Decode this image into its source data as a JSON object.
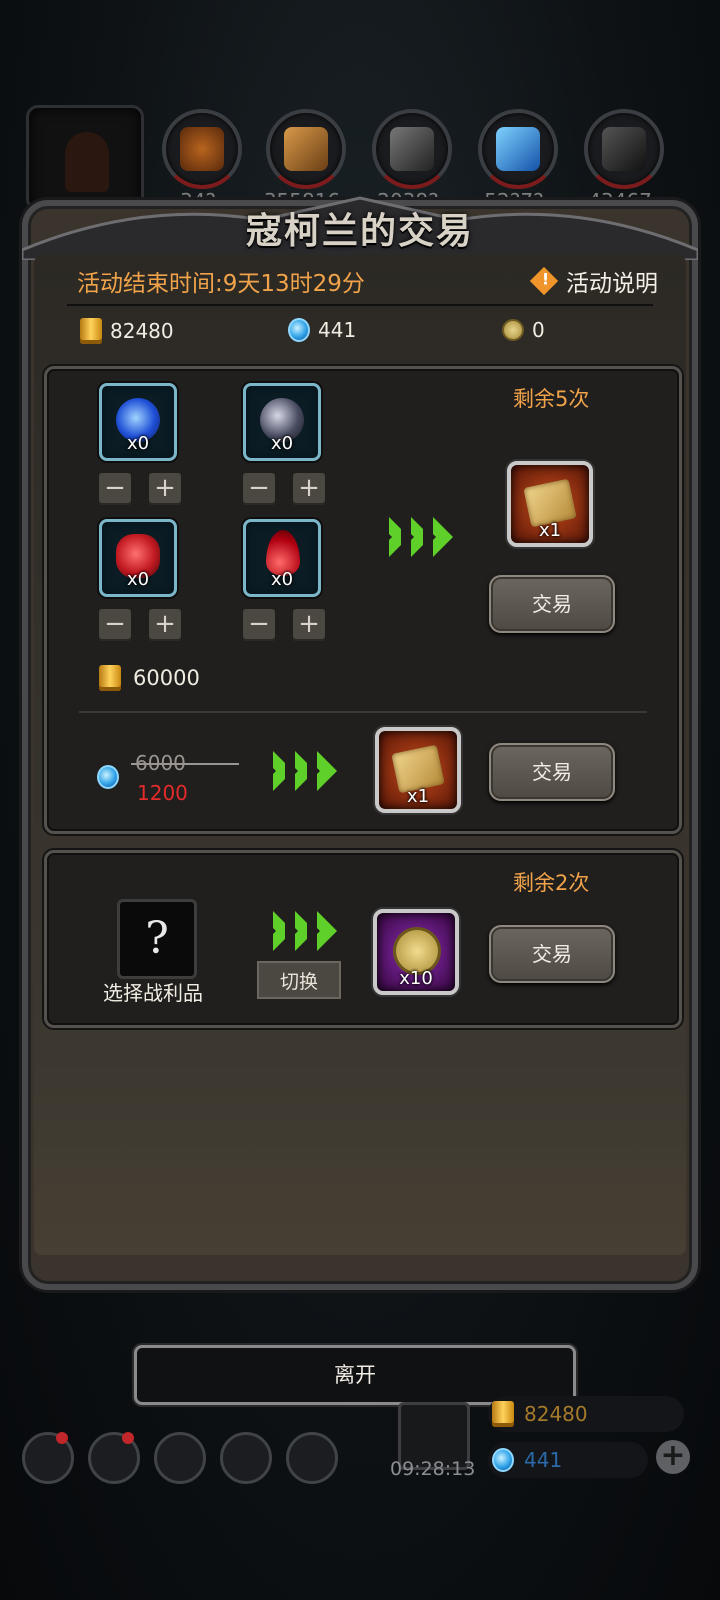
{
  "top_resources": {
    "values": [
      "34?",
      "355816",
      "2038?",
      "52?7?",
      "43467"
    ]
  },
  "modal": {
    "title": "寇柯兰的交易",
    "end_time_label": "活动结束时间:9天13时29分",
    "help_label": "活动说明",
    "help_mark": "!",
    "currency": {
      "gold": "82480",
      "gem": "441",
      "token": "0"
    }
  },
  "panel1": {
    "remaining": "剩余5次",
    "materials": [
      {
        "name": "blue-orb",
        "count": "x0",
        "color": "#2f6cff"
      },
      {
        "name": "dark-ore",
        "count": "x0",
        "color": "#6a6f86"
      },
      {
        "name": "red-crystal",
        "count": "x0",
        "color": "#d8202a"
      },
      {
        "name": "blood-drop",
        "count": "x0",
        "color": "#c4101a"
      }
    ],
    "minus": "−",
    "plus": "+",
    "gold_cost": "60000",
    "reward_count": "x1",
    "trade_label": "交易",
    "gem_price_old": "6000",
    "gem_price_new": "1200",
    "reward2_count": "x1",
    "trade2_label": "交易"
  },
  "panel2": {
    "remaining": "剩余2次",
    "mystery_mark": "?",
    "choose_label": "选择战利品",
    "switch_label": "切换",
    "reward_count": "x10",
    "trade_label": "交易"
  },
  "leave_label": "离开",
  "hud": {
    "clock": "09:28:13",
    "gold": "82480",
    "gem": "441",
    "add": "+"
  }
}
